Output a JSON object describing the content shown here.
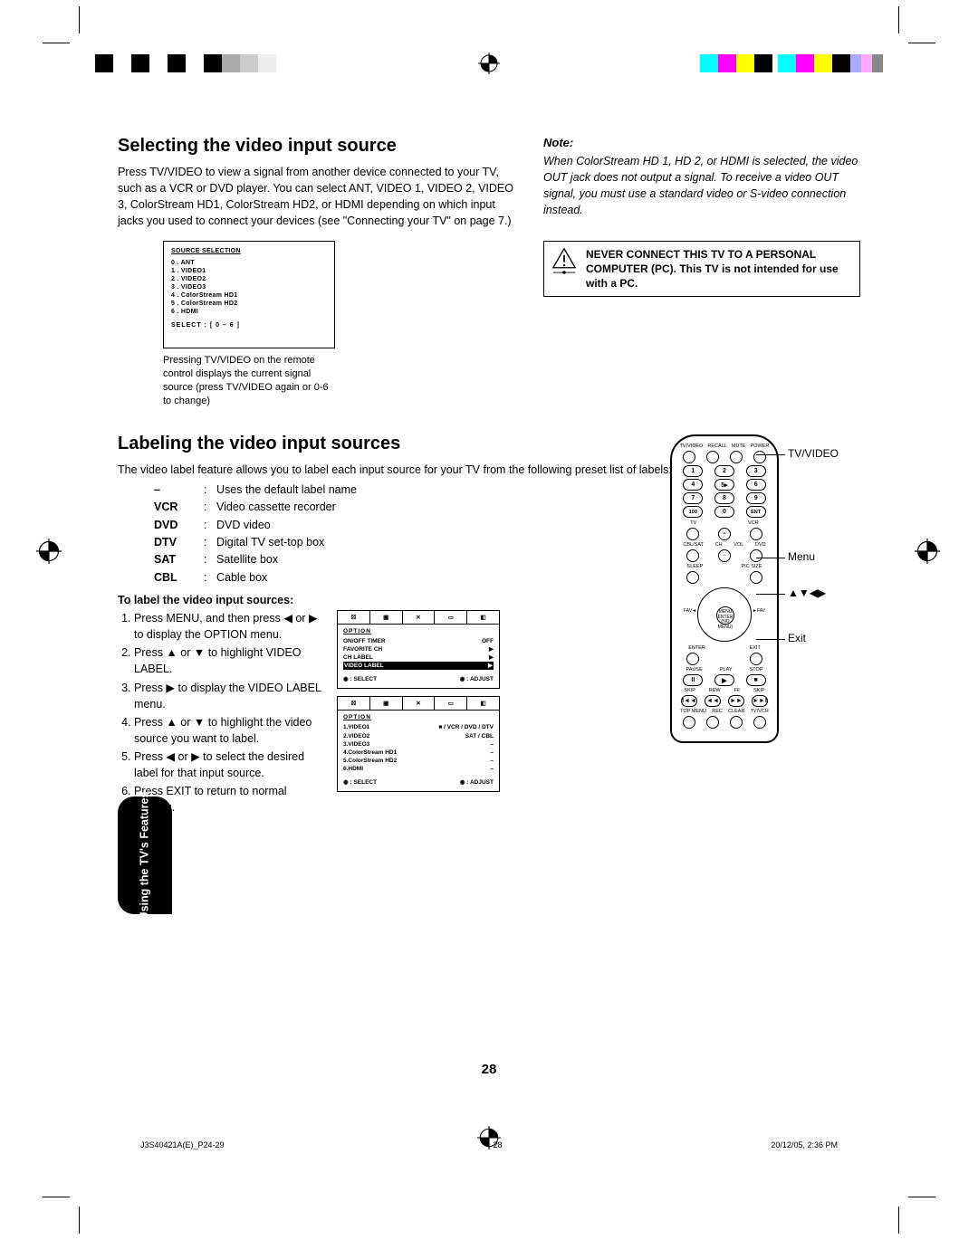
{
  "heading1": "Selecting the video input source",
  "para1": "Press TV/VIDEO to view a signal from another device connected to your TV, such as a VCR or DVD player. You can select ANT, VIDEO 1, VIDEO 2, VIDEO 3, ColorStream HD1, ColorStream HD2, or HDMI depending on which input jacks you used to connect your devices (see \"Connecting your TV\" on page 7.)",
  "osd1": {
    "title": "SOURCE SELECTION",
    "items": [
      "0 . ANT",
      "1 . VIDEO1",
      "2 . VIDEO2",
      "3 . VIDEO3",
      "4 . ColorStream HD1",
      "5 . ColorStream HD2",
      "6 . HDMI"
    ],
    "select": "SELECT : [ 0 – 6 ]"
  },
  "caption1": "Pressing TV/VIDEO on the remote control displays the current signal source (press TV/VIDEO again or 0-6 to change)",
  "note": {
    "title": "Note:",
    "body": "When ColorStream HD 1, HD 2, or HDMI is selected, the video OUT jack does not output a signal. To receive a video OUT signal, you must use a standard video or S-video connection instead."
  },
  "warning": {
    "line1": "NEVER CONNECT THIS TV TO A PERSONAL COMPUTER (PC).",
    "line2": "This TV is not intended for use with a PC."
  },
  "heading2": "Labeling the video input sources",
  "para2": "The video label feature allows you to label each input source for your TV from the following preset list of labels:",
  "labels": [
    {
      "k": "–",
      "v": "Uses the default label name"
    },
    {
      "k": "VCR",
      "v": "Video cassette recorder"
    },
    {
      "k": "DVD",
      "v": "DVD video"
    },
    {
      "k": "DTV",
      "v": "Digital TV set-top box"
    },
    {
      "k": "SAT",
      "v": "Satellite box"
    },
    {
      "k": "CBL",
      "v": "Cable box"
    }
  ],
  "steps_heading": "To label the video input sources:",
  "steps": [
    "Press MENU, and then press ◀ or ▶ to display the OPTION menu.",
    "Press ▲ or ▼ to highlight VIDEO LABEL.",
    "Press ▶ to display the VIDEO LABEL menu.",
    "Press ▲ or ▼ to highlight the video source you want to label.",
    "Press ◀ or ▶ to select the desired label for that input source.",
    "Press EXIT to return to normal viewing."
  ],
  "mini_osd1": {
    "title": "OPTION",
    "lines": [
      {
        "l": "ON/OFF TIMER",
        "r": "OFF"
      },
      {
        "l": "FAVORITE CH",
        "r": "▶"
      },
      {
        "l": "CH LABEL",
        "r": "▶"
      },
      {
        "l": "VIDEO LABEL",
        "r": "▶"
      }
    ],
    "footer": {
      "l": "◉ : SELECT",
      "r": "◉ : ADJUST"
    }
  },
  "mini_osd2": {
    "title": "OPTION",
    "lines": [
      {
        "l": "1.VIDEO1",
        "r": "■ / VCR / DVD / DTV"
      },
      {
        "l": "2.VIDEO2",
        "r": "SAT / CBL"
      },
      {
        "l": "3.VIDEO3",
        "r": "–"
      },
      {
        "l": "4.ColorStream  HD1",
        "r": "–"
      },
      {
        "l": "5.ColorStream  HD2",
        "r": "–"
      },
      {
        "l": "6.HDMI",
        "r": "–"
      }
    ],
    "footer": {
      "l": "◉ : SELECT",
      "r": "◉ : ADJUST"
    }
  },
  "remote_callouts": {
    "tvvideo": "TV/VIDEO",
    "menu": "Menu",
    "arrows": "▲▼◀▶",
    "exit": "Exit"
  },
  "side_tab": "Using the TV's\nFeatures",
  "page_number": "28",
  "footer": {
    "left": "J3S40421A(E)_P24-29",
    "mid": "28",
    "right": "20/12/05, 2:36 PM"
  }
}
